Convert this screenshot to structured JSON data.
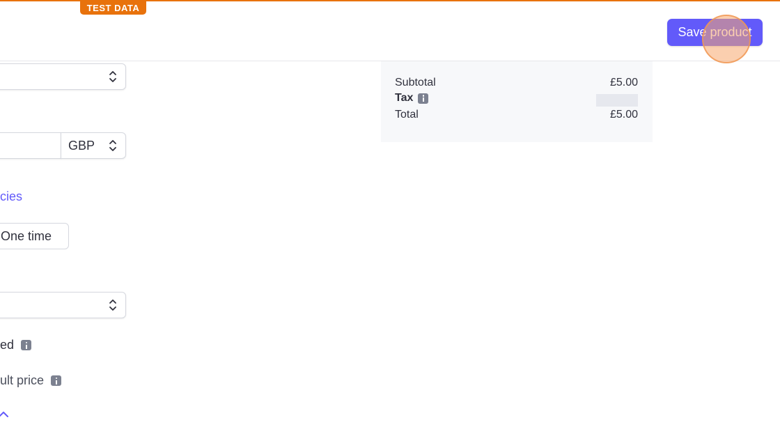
{
  "header": {
    "badge": "TEST DATA",
    "save_label": "Save product"
  },
  "form": {
    "currency": "GBP",
    "currencies_link": "cies",
    "billing_type": "One time",
    "billed_label": "ed",
    "default_price_label": "ult price"
  },
  "summary": {
    "subtotal_label": "Subtotal",
    "subtotal_value": "£5.00",
    "tax_label": "Tax",
    "total_label": "Total",
    "total_value": "£5.00"
  },
  "colors": {
    "accent": "#625afa",
    "test_banner": "#e8720c"
  }
}
